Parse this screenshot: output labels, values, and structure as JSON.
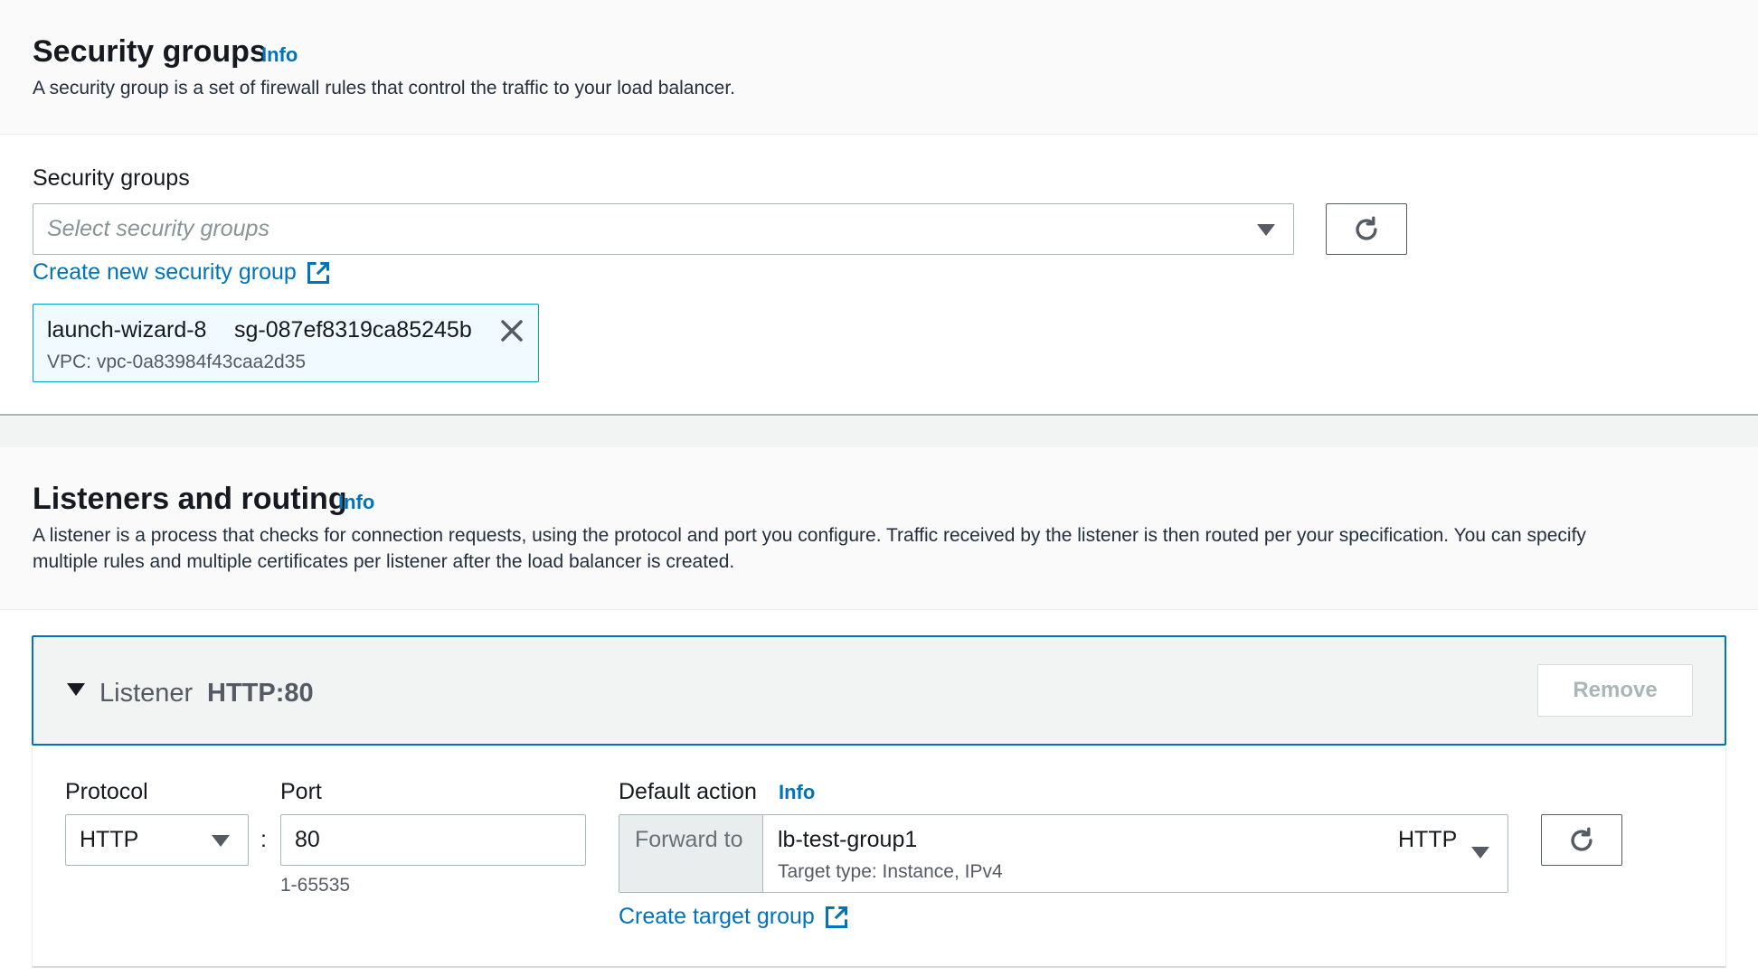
{
  "security_groups_section": {
    "title": "Security groups",
    "info": "Info",
    "description": "A security group is a set of firewall rules that control the traffic to your load balancer.",
    "field_label": "Security groups",
    "placeholder": "Select security groups",
    "create_link": "Create new security group",
    "selected": [
      {
        "name": "launch-wizard-8",
        "id": "sg-087ef8319ca85245b",
        "vpc": "VPC: vpc-0a83984f43caa2d35"
      }
    ]
  },
  "listeners_section": {
    "title": "Listeners and routing",
    "info": "Info",
    "description_line1": "A listener is a process that checks for connection requests, using the protocol and port you configure. Traffic received by the listener is then routed per your specification. You can specify",
    "description_line2": "multiple rules and multiple certificates per listener after the load balancer is created.",
    "listener": {
      "label": "Listener",
      "value": "HTTP:80",
      "remove_label": "Remove",
      "protocol_label": "Protocol",
      "protocol_value": "HTTP",
      "separator": ":",
      "port_label": "Port",
      "port_value": "80",
      "port_hint": "1-65535",
      "default_action_label": "Default action",
      "default_action_info": "Info",
      "forward_prefix": "Forward to",
      "target_group_name": "lb-test-group1",
      "target_group_protocol": "HTTP",
      "target_type": "Target type: Instance, IPv4",
      "create_target_link": "Create target group"
    }
  },
  "colors": {
    "link": "#0073bb",
    "token_bg": "#f1faff",
    "token_border": "#00a1c9",
    "active_border": "#0073bb"
  },
  "icons": [
    "caret-down-icon",
    "refresh-icon",
    "external-link-icon",
    "close-icon",
    "expand-caret-icon"
  ]
}
